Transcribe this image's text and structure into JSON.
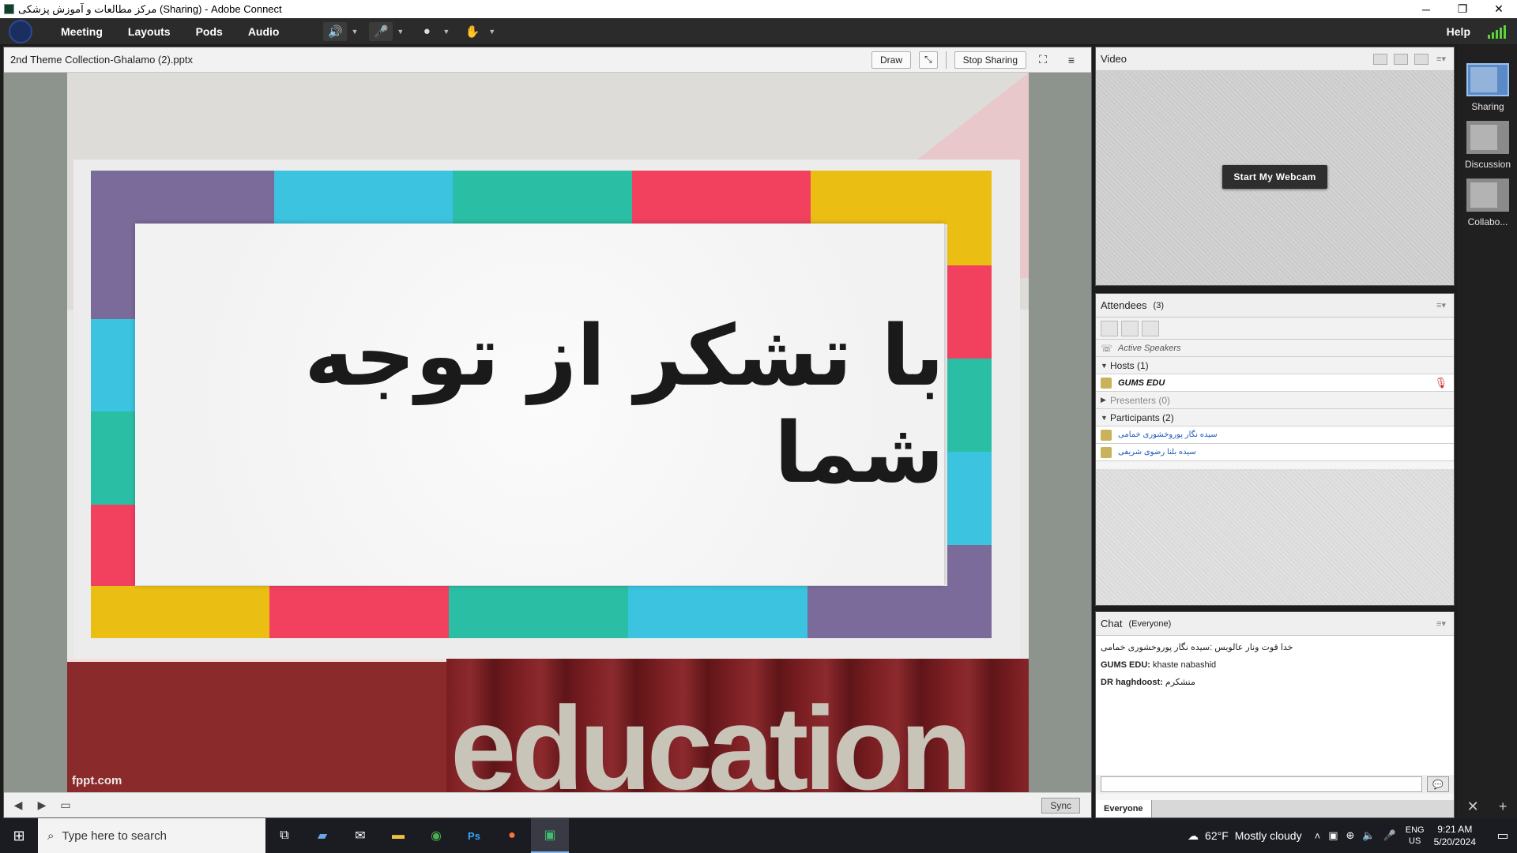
{
  "window": {
    "title": "مرکز مطالعات و آموزش پزشکی (Sharing) - Adobe Connect",
    "minimize": "─",
    "maximize": "❐",
    "close": "✕"
  },
  "menubar": {
    "items": [
      "Meeting",
      "Layouts",
      "Pods",
      "Audio"
    ],
    "help": "Help",
    "speaker_icon": "speaker-icon",
    "mic_icon": "microphone-icon",
    "camera_icon": "webcam-icon",
    "raise_hand_icon": "raise-hand-icon"
  },
  "share_pod": {
    "title": "2nd Theme Collection-Ghalamo (2).pptx",
    "draw_label": "Draw",
    "stop_sharing_label": "Stop Sharing",
    "sync_label": "Sync",
    "slide": {
      "heading": "با تشکر از توجه شما",
      "word": "education",
      "credit": "fppt.com"
    }
  },
  "video_pod": {
    "title": "Video",
    "webcam_button": "Start My Webcam"
  },
  "attendees_pod": {
    "title": "Attendees",
    "count": "(3)",
    "active_speakers": "Active Speakers",
    "hosts_label": "Hosts (1)",
    "host_name": "GUMS EDU",
    "presenters_label": "Presenters (0)",
    "participants_label": "Participants (2)",
    "participants": [
      "سیده نگار پوروخشوری خمامی",
      "سیده بلنا رضوی شریفی"
    ]
  },
  "chat_pod": {
    "title": "Chat",
    "scope": "(Everyone)",
    "messages": [
      {
        "from": "",
        "text": "خدا قوت ونار عالویس :سیده نگار پوروخشوری خمامی"
      },
      {
        "from": "GUMS EDU:",
        "text": " khaste nabashid"
      },
      {
        "from": "DR haghdoost:",
        "text": " متشکرم"
      }
    ],
    "tab": "Everyone"
  },
  "layouts": {
    "items": [
      "Sharing",
      "Discussion",
      "Collabo..."
    ]
  },
  "taskbar": {
    "search_placeholder": "Type here to search",
    "weather_temp": "62°F",
    "weather_text": "Mostly cloudy",
    "lang": "ENG",
    "region": "US",
    "time": "9:21 AM",
    "date": "5/20/2024"
  },
  "colors": {
    "purple": "#7b6b9a",
    "cyan": "#3bc3df",
    "teal": "#2abfa5",
    "red": "#f2405f",
    "yellow": "#ebbe14",
    "accent_green": "#5bd43a"
  }
}
